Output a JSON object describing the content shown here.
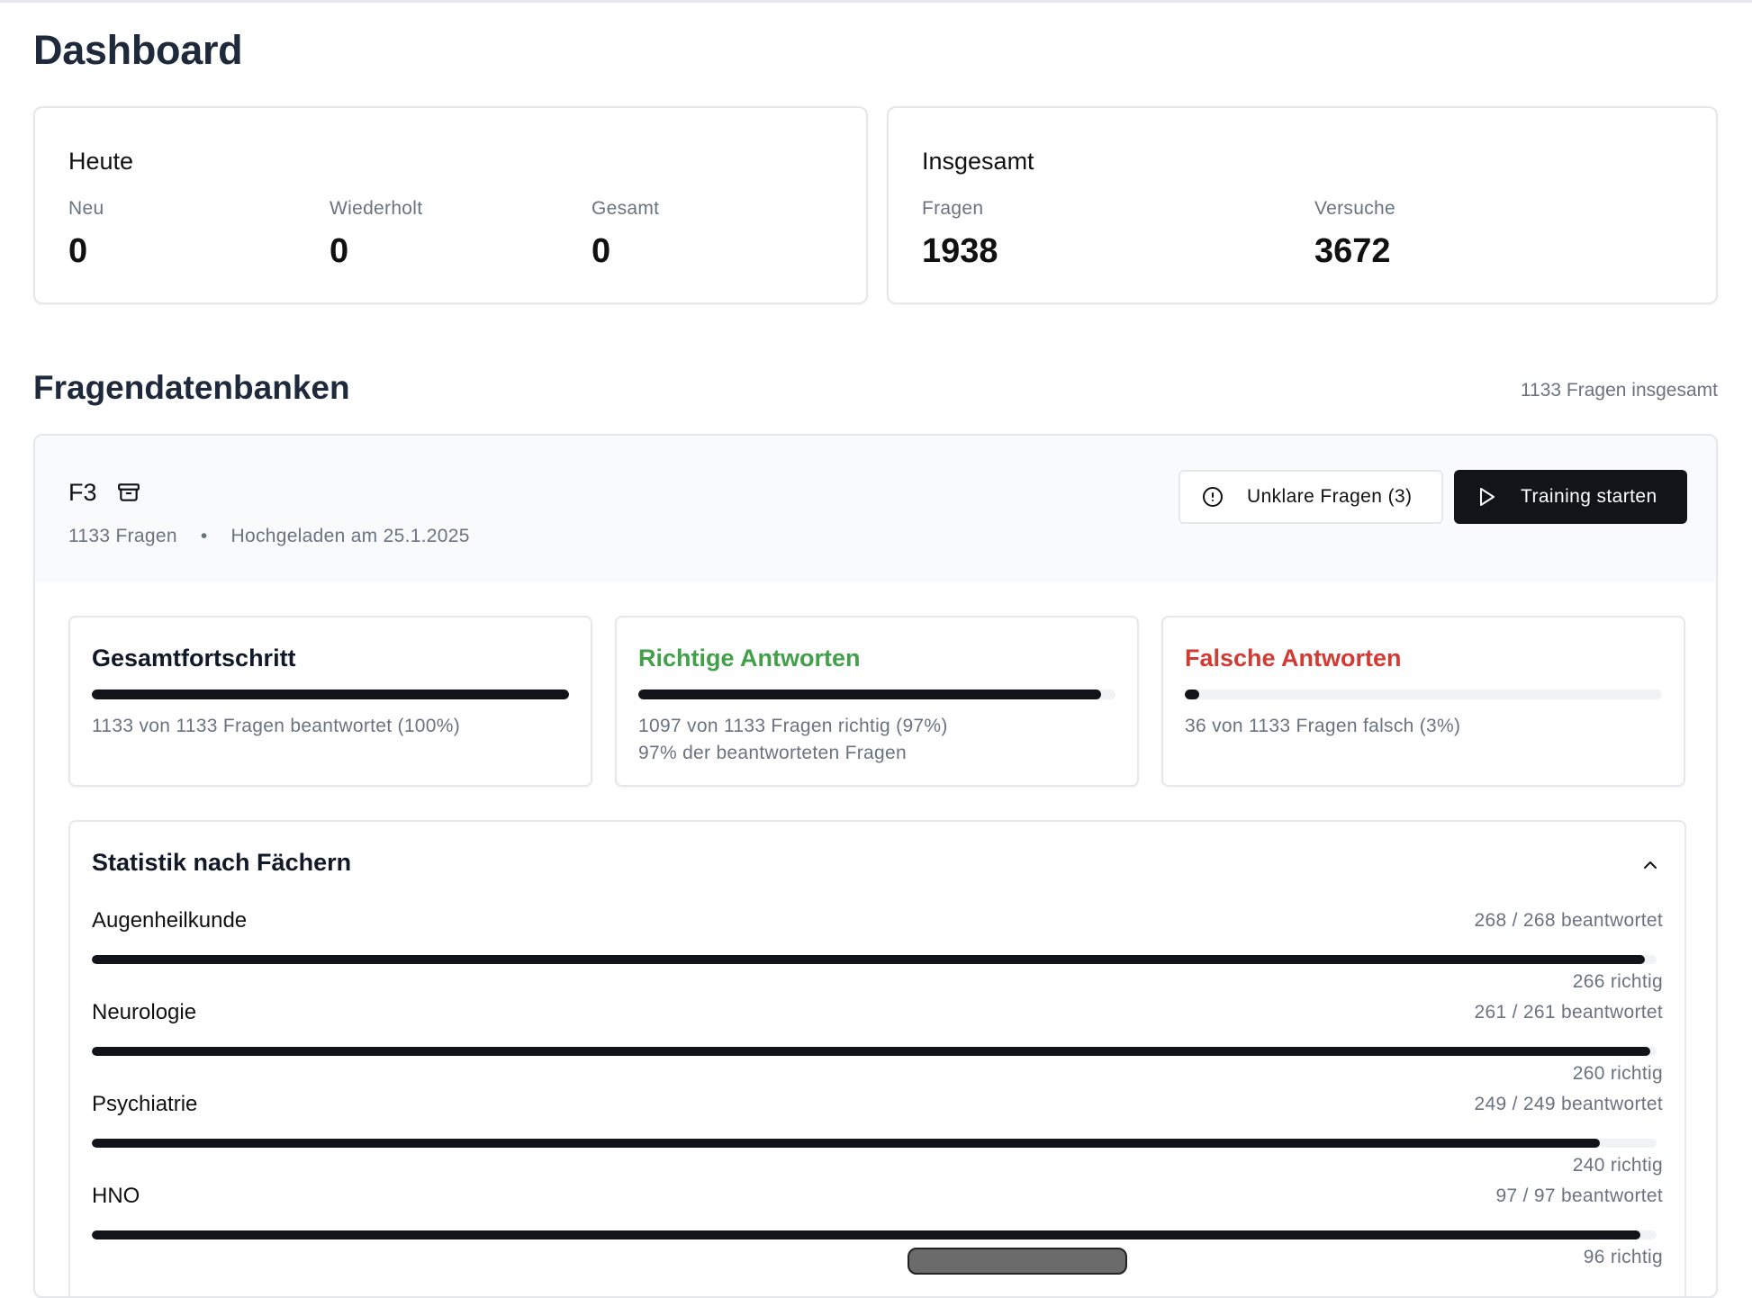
{
  "page": {
    "title": "Dashboard"
  },
  "today": {
    "title": "Heute",
    "stats": [
      {
        "label": "Neu",
        "value": "0"
      },
      {
        "label": "Wiederholt",
        "value": "0"
      },
      {
        "label": "Gesamt",
        "value": "0"
      }
    ]
  },
  "overall": {
    "title": "Insgesamt",
    "stats": [
      {
        "label": "Fragen",
        "value": "1938"
      },
      {
        "label": "Versuche",
        "value": "3672"
      }
    ]
  },
  "databases": {
    "title": "Fragendatenbanken",
    "total": "1133 Fragen insgesamt",
    "items": [
      {
        "name": "F3",
        "count": "1133 Fragen",
        "separator": "•",
        "uploaded": "Hochgeladen am 25.1.2025",
        "unclear_button": "Unklare Fragen (3)",
        "train_button": "Training starten",
        "progress": {
          "overall": {
            "title": "Gesamtfortschritt",
            "fraction": 1.0,
            "text": "1133 von 1133 Fragen beantwortet (100%)"
          },
          "correct": {
            "title": "Richtige Antworten",
            "fraction": 0.97,
            "text": "1097 von 1133 Fragen richtig (97%)",
            "subtext": "97% der beantworteten Fragen"
          },
          "wrong": {
            "title": "Falsche Antworten",
            "fraction": 0.03,
            "text": "36 von 1133 Fragen falsch (3%)"
          }
        },
        "subjects": {
          "title": "Statistik nach Fächern",
          "items": [
            {
              "name": "Augenheilkunde",
              "answered": "268 / 268 beantwortet",
              "correct": "266 richtig",
              "fraction": 0.9925
            },
            {
              "name": "Neurologie",
              "answered": "261 / 261 beantwortet",
              "correct": "260 richtig",
              "fraction": 0.9962
            },
            {
              "name": "Psychiatrie",
              "answered": "249 / 249 beantwortet",
              "correct": "240 richtig",
              "fraction": 0.9639
            },
            {
              "name": "HNO",
              "answered": "97 / 97 beantwortet",
              "correct": "96 richtig",
              "fraction": 0.9897
            }
          ]
        }
      }
    ]
  },
  "colors": {
    "accent_dark": "#111418",
    "correct": "#43a04a",
    "wrong": "#d23a34"
  },
  "icons": [
    "archive-icon",
    "alert-circle-icon",
    "play-icon",
    "chevron-up-icon"
  ]
}
